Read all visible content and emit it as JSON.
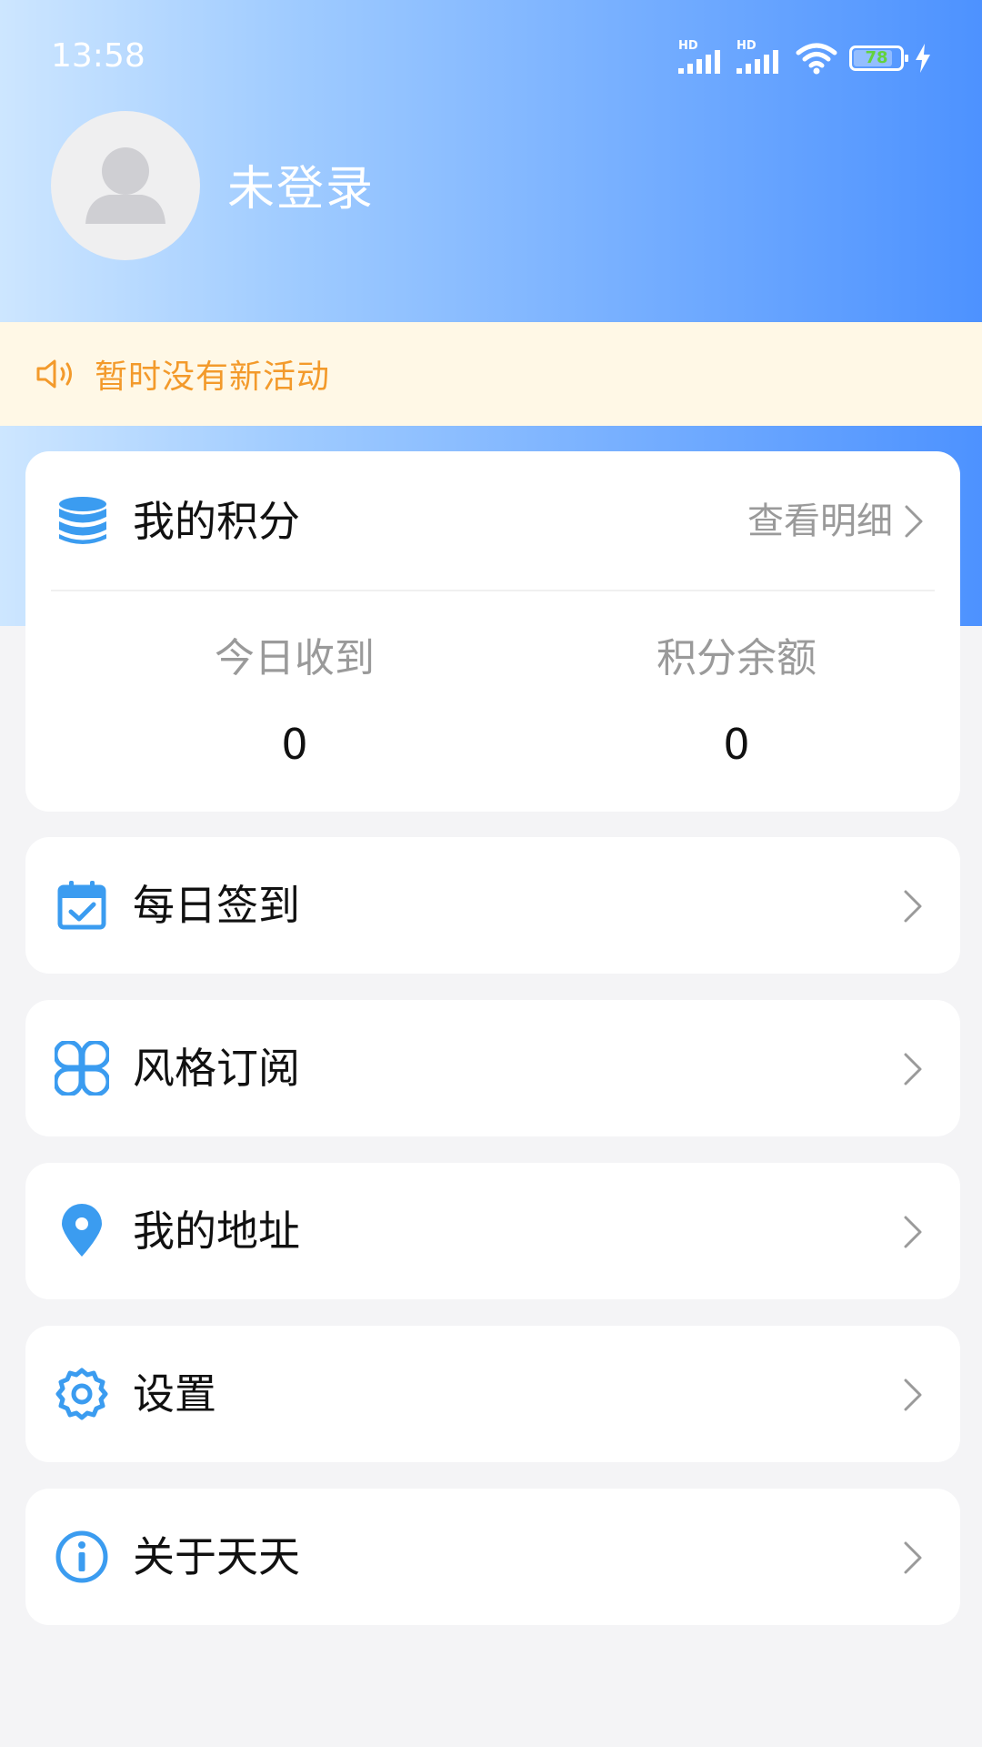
{
  "status_bar": {
    "time": "13:58",
    "signal1_label": "HD",
    "signal2_label": "HD",
    "battery_level": "78"
  },
  "profile": {
    "name": "未登录",
    "avatar_icon": "person-avatar-icon"
  },
  "notice": {
    "icon": "speaker-icon",
    "text": "暂时没有新活动"
  },
  "points": {
    "icon": "database-icon",
    "title": "我的积分",
    "detail_link": "查看明细",
    "today_label": "今日收到",
    "today_value": "0",
    "balance_label": "积分余额",
    "balance_value": "0"
  },
  "menu": [
    {
      "icon": "calendar-check-icon",
      "label": "每日签到"
    },
    {
      "icon": "grid-icon",
      "label": "风格订阅"
    },
    {
      "icon": "location-pin-icon",
      "label": "我的地址"
    },
    {
      "icon": "gear-icon",
      "label": "设置"
    },
    {
      "icon": "info-icon",
      "label": "关于天天"
    }
  ],
  "colors": {
    "accent": "#3b9cf0",
    "notice_text": "#f39a2b",
    "notice_bg": "#fff8e6",
    "header_gradient_start": "#cde6ff",
    "header_gradient_end": "#4d92ff"
  }
}
